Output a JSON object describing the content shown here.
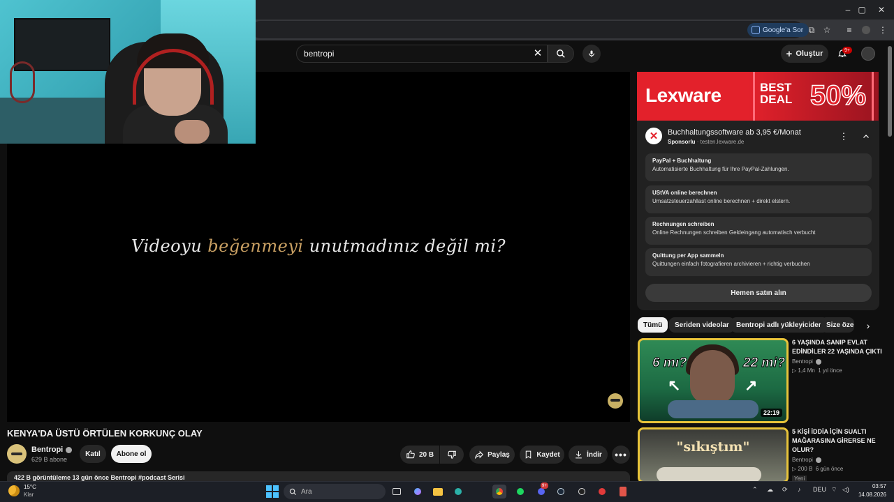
{
  "browser": {
    "google_ask_label": "Google'a Sor",
    "window_controls": [
      "–",
      "▢",
      "✕"
    ]
  },
  "yt": {
    "search_value": "bentropi",
    "create_label": "Oluştur",
    "notification_count": "9+"
  },
  "player": {
    "overlay_text_before": "Videoyu ",
    "overlay_text_highlight": "beğenmeyi",
    "overlay_text_after": " unutmadınız değil mi?"
  },
  "video": {
    "title": "KENYA'DA ÜSTÜ ÖRTÜLEN KORKUNÇ OLAY",
    "channel_name": "Bentropi",
    "subscribers": "629 B abone",
    "join_label": "Katıl",
    "subscribe_label": "Abone ol",
    "likes": "20 B",
    "share_label": "Paylaş",
    "save_label": "Kaydet",
    "download_label": "İndir",
    "description_partial": "422 B görüntüleme  13 gün önce  Bentropi  #podcast Serisi"
  },
  "ad": {
    "banner_brand": "Lexware",
    "banner_deal": "BEST DEAL",
    "banner_percent": "50%",
    "title": "Buchhaltungssoftware ab 3,95 €/Monat",
    "sponsored_label": "Sponsorlu",
    "domain": "testen.lexware.de",
    "sitelinks": [
      {
        "title": "PayPal + Buchhaltung",
        "desc": "Automatisierte Buchhaltung für Ihre PayPal-Zahlungen."
      },
      {
        "title": "UStVA online berechnen",
        "desc": "Umsatzsteuerzahllast online berechnen + direkt elstern."
      },
      {
        "title": "Rechnungen schreiben",
        "desc": "Online Rechnungen schreiben Geldeingang automatisch verbucht"
      },
      {
        "title": "Quittung per App sammeln",
        "desc": "Quittungen einfach fotografieren archivieren + richtig verbuchen"
      }
    ],
    "cta_label": "Hemen satın alın"
  },
  "chips": [
    "Tümü",
    "Seriden videolar",
    "Bentropi adlı yükleyiciden",
    "Size özel"
  ],
  "recommendations": [
    {
      "title": "6 YAŞINDA SANIP EVLAT EDİNDİLER 22 YAŞINDA ÇIKTI",
      "channel": "Bentropi",
      "views": "▷ 1,4 Mn",
      "age": "1 yıl önce",
      "duration": "22:19",
      "thumb_left_text": "6 mı?",
      "thumb_right_text": "22 mi?"
    },
    {
      "title": "5 KİŞİ İDDİA İÇİN SUALTI MAĞARASINA GİRERSE NE OLUR?",
      "channel": "Bentropi",
      "views": "▷ 200 B",
      "age": "6 gün önce",
      "badge": "Yeni",
      "thumb_text": "\"sıkıştım\""
    }
  ],
  "taskbar": {
    "temperature": "15°C",
    "condition": "Klar",
    "search_placeholder": "Ara",
    "discord_badge": "9+",
    "language": "DEU",
    "time": "03:57",
    "date": "14.08.2026"
  },
  "colors": {
    "background": "#0f0f0f",
    "accent_red": "#cc0000",
    "lexware_red": "#e3212b",
    "thumbnail_border": "#e8c43a",
    "overlay_highlight": "#c9a063"
  }
}
